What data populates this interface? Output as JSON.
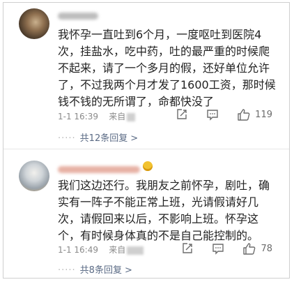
{
  "comments": [
    {
      "text": "我怀孕一直吐到6个月，一度呕吐到医院4次，挂盐水，吃中药，吐的最严重的时候爬不起来，请了一个多月的假，还好单位允许了，不过我两个月才发了1600工资，那时候钱不钱的无所谓了，命都快没了",
      "time": "1-1 16:39",
      "source_prefix": "来自",
      "likes": "119",
      "replies_label": "共12条回复"
    },
    {
      "text": "我们这边还行。我朋友之前怀孕，剧吐，确实有一阵子不能正常上班，光请假请好几次，请假回来以后，不影响上班。怀孕这个，有时候身体真的不是自己能控制的。",
      "time": "1-1 16:49",
      "source_prefix": "来自",
      "likes": "78",
      "replies_label": "共8条回复"
    }
  ],
  "icons": {
    "repost": "repost-icon",
    "comment": "comment-icon",
    "like": "thumbs-up-icon",
    "chevron": "chevron-right-icon"
  },
  "colors": {
    "text": "#222222",
    "meta": "#8a8a8a",
    "link": "#5b6b85",
    "icon": "#6c6c6c"
  }
}
